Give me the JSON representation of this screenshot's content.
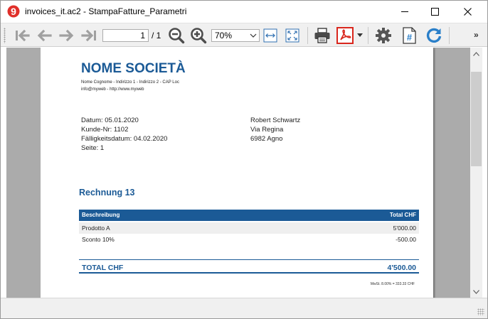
{
  "window": {
    "title": "invoices_it.ac2 - StampaFatture_Parametri",
    "app_icon_glyph": "9"
  },
  "toolbar": {
    "page_value": "1",
    "page_total": "/ 1",
    "zoom_value": "70%",
    "more_label": "»",
    "icons": [
      "first-page-icon",
      "previous-page-icon",
      "next-page-icon",
      "last-page-icon",
      "zoom-out-icon",
      "zoom-in-icon",
      "fit-width-icon",
      "fit-page-icon",
      "print-icon",
      "pdf-icon",
      "settings-icon",
      "page-number-icon",
      "refresh-icon"
    ]
  },
  "document": {
    "company_name": "NOME SOCIETÀ",
    "address_line1": "Nome Cognome - Indirizzo 1 - Indirizzo 2 - CAP Loc",
    "address_line2": "info@myweb - http://www.myweb",
    "left_info": [
      "Datum: 05.01.2020",
      "Kunde-Nr: 1102",
      "Fälligkeitsdatum: 04.02.2020",
      "Seite: 1"
    ],
    "right_info": [
      "Robert Schwartz",
      "Via Regina",
      "6982 Agno"
    ],
    "invoice_title": "Rechnung 13",
    "table": {
      "headers": [
        "Beschreibung",
        "Total CHF"
      ],
      "rows": [
        {
          "description": "Prodotto A",
          "amount": "5'000.00"
        },
        {
          "description": "Sconto 10%",
          "amount": "-500.00"
        }
      ]
    },
    "total_label": "TOTAL CHF",
    "total_value": "4'500.00",
    "vat_note": "MwSt. 8.00% = 333.33 CHF"
  },
  "colors": {
    "brand_blue": "#1b5a96",
    "pdf_red": "#d9261c",
    "refresh_blue": "#2a7fc9",
    "app_icon_red": "#e0302a"
  }
}
